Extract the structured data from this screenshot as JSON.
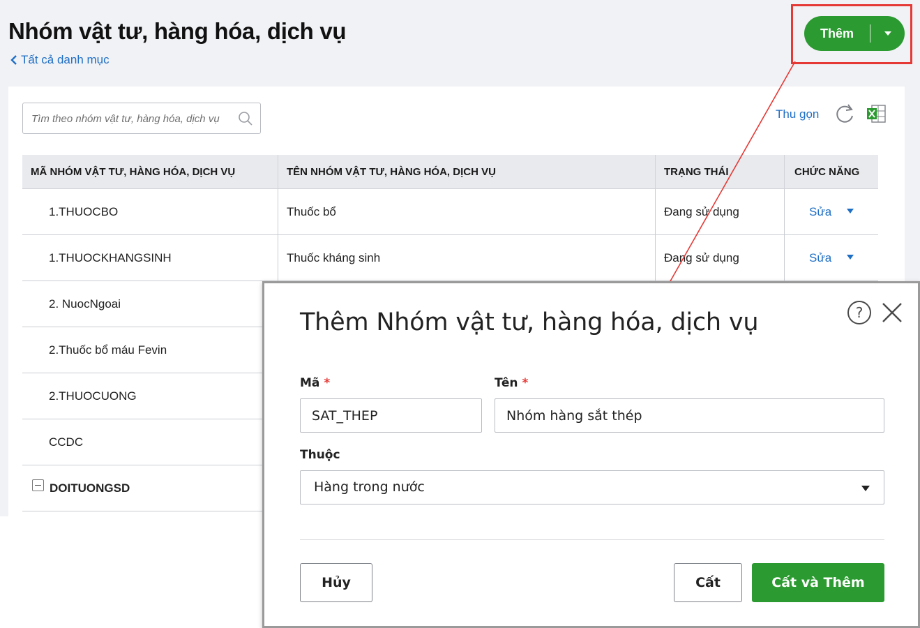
{
  "page": {
    "title": "Nhóm vật tư, hàng hóa, dịch vụ",
    "back_link": "Tất cả danh mục"
  },
  "toolbar": {
    "add_label": "Thêm",
    "search_placeholder": "Tìm theo nhóm vật tư, hàng hóa, dịch vụ",
    "collapse_label": "Thu gọn"
  },
  "table": {
    "columns": [
      "MÃ NHÓM VẬT TƯ, HÀNG HÓA, DỊCH VỤ",
      "TÊN NHÓM VẬT TƯ, HÀNG HÓA, DỊCH VỤ",
      "TRẠNG THÁI",
      "CHỨC NĂNG"
    ],
    "rows": [
      {
        "code": "1.THUOCBO",
        "name": "Thuốc bổ",
        "status": "Đang sử dụng",
        "action": "Sửa"
      },
      {
        "code": "1.THUOCKHANGSINH",
        "name": "Thuốc kháng sinh",
        "status": "Đang sử dụng",
        "action": "Sửa"
      },
      {
        "code": "2. NuocNgoai"
      },
      {
        "code": "2.Thuốc bổ máu Fevin"
      },
      {
        "code": "2.THUOCUONG"
      },
      {
        "code": "CCDC"
      },
      {
        "code": "DOITUONGSD"
      }
    ]
  },
  "modal": {
    "title": "Thêm Nhóm vật tư, hàng hóa, dịch vụ",
    "code_label": "Mã",
    "code_value": "SAT_THEP",
    "name_label": "Tên",
    "name_value": "Nhóm hàng sắt thép",
    "required_mark": "*",
    "parent_label": "Thuộc",
    "parent_value": "Hàng trong nước",
    "cancel_label": "Hủy",
    "save_label": "Cất",
    "save_add_label": "Cất và Thêm"
  },
  "colors": {
    "accent_green": "#2b9a30",
    "link_blue": "#1f6fc5",
    "highlight_red": "#e53935"
  }
}
